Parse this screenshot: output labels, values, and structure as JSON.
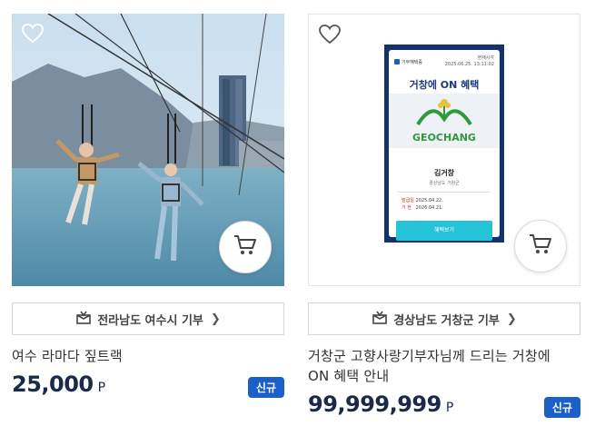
{
  "products": [
    {
      "donate_label": "전라남도 여수시 기부",
      "title": "여수 라마다 짚트랙",
      "price": "25,000",
      "unit": "P",
      "badge": "신규"
    },
    {
      "donate_label": "경상남도 거창군 기부",
      "title_line1": "거창군 고향사랑기부자님께 드리는 거창에",
      "title_line2": "ON 혜택 안내",
      "price": "99,999,999",
      "unit": "P",
      "badge": "신규",
      "ticket": {
        "brand": "기부혜택증",
        "issued_label": "현재시각",
        "issued_time": "2025.06.25. 13:11:02",
        "headline": "거창에 ON 혜택",
        "logo_text": "GEOCHANG",
        "holder_name": "김거창",
        "holder_address": "경상남도 거창군",
        "issue_key": "발급일",
        "issue_date": "2025.04.22.",
        "expire_key": "기 한",
        "expire_date": "2026.04.21.",
        "button_label": "혜택보기"
      }
    }
  ],
  "icons": {
    "favorite": "heart-outline-icon",
    "cart": "cart-icon",
    "donate": "gift-box-icon",
    "chevron": "chevron-right-icon"
  },
  "colors": {
    "price": "#1b2a4a",
    "badge": "#1d5fc9",
    "ticket_frame": "#12326b",
    "ticket_button": "#25c3d8",
    "logo_green": "#2f9a3a"
  }
}
